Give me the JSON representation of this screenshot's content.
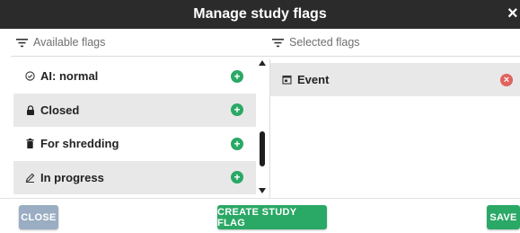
{
  "dialog": {
    "title": "Manage study flags",
    "close_glyph": "×"
  },
  "available": {
    "header": "Available flags",
    "header_icon": "filter-icon",
    "items": [
      {
        "label": "AI: normal",
        "icon": "check-circle-icon",
        "add": "+"
      },
      {
        "label": "Closed",
        "icon": "lock-icon",
        "add": "+"
      },
      {
        "label": "For shredding",
        "icon": "trash-icon",
        "add": "+"
      },
      {
        "label": "In progress",
        "icon": "pencil-icon",
        "add": "+"
      }
    ]
  },
  "selected": {
    "header": "Selected flags",
    "header_icon": "filter-icon",
    "items": [
      {
        "label": "Event",
        "icon": "calendar-icon",
        "remove": "×"
      }
    ]
  },
  "footer": {
    "close_label": "CLOSE",
    "create_label": "CREATE STUDY FLAG",
    "save_label": "SAVE"
  },
  "colors": {
    "titlebar": "#2b2b2b",
    "row_alt": "#e8e8e8",
    "add_green": "#2aa866",
    "remove_red": "#e0635d",
    "close_button": "#9aadc2"
  }
}
